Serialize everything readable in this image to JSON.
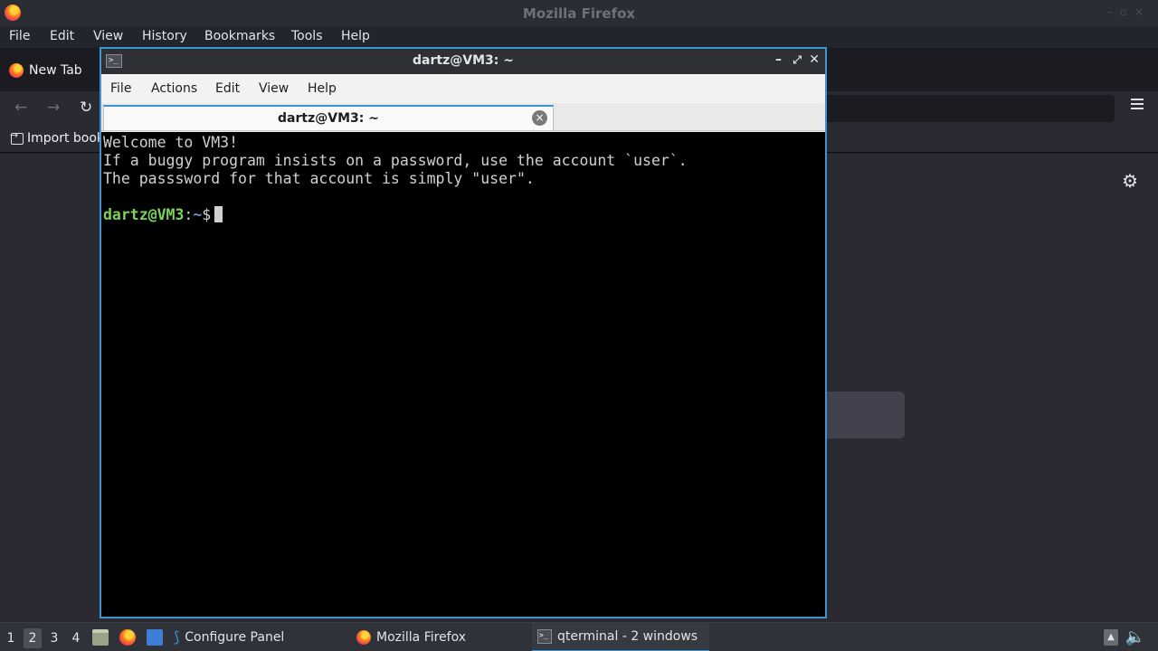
{
  "firefox": {
    "window_title": "Mozilla Firefox",
    "menu": [
      "File",
      "Edit",
      "View",
      "History",
      "Bookmarks",
      "Tools",
      "Help"
    ],
    "tab_label": "New Tab",
    "bookmark_label": "Import book"
  },
  "terminal": {
    "window_title": "dartz@VM3: ~",
    "menu": [
      "File",
      "Actions",
      "Edit",
      "View",
      "Help"
    ],
    "tab_label": "dartz@VM3: ~",
    "lines": [
      "Welcome to VM3!",
      "If a buggy program insists on a password, use the account `user`.",
      "The passsword for that account is simply \"user\"."
    ],
    "prompt_user": "dartz@VM3",
    "prompt_sep": ":",
    "prompt_path": "~",
    "prompt_symbol": "$"
  },
  "taskbar": {
    "desktops": [
      "1",
      "2",
      "3",
      "4"
    ],
    "active_desktop": "2",
    "tasks": {
      "configure_panel": "Configure Panel",
      "firefox": "Mozilla Firefox",
      "qterminal": "qterminal - 2 windows"
    }
  },
  "colors": {
    "accent": "#3a94d8",
    "prompt_user": "#7cd35a",
    "prompt_path": "#6f8fdc",
    "terminal_bg": "#000000"
  },
  "icons": {
    "firefox": "firefox-icon",
    "terminal": "terminal-icon",
    "settings": "gear-icon",
    "volume": "speaker-icon"
  }
}
